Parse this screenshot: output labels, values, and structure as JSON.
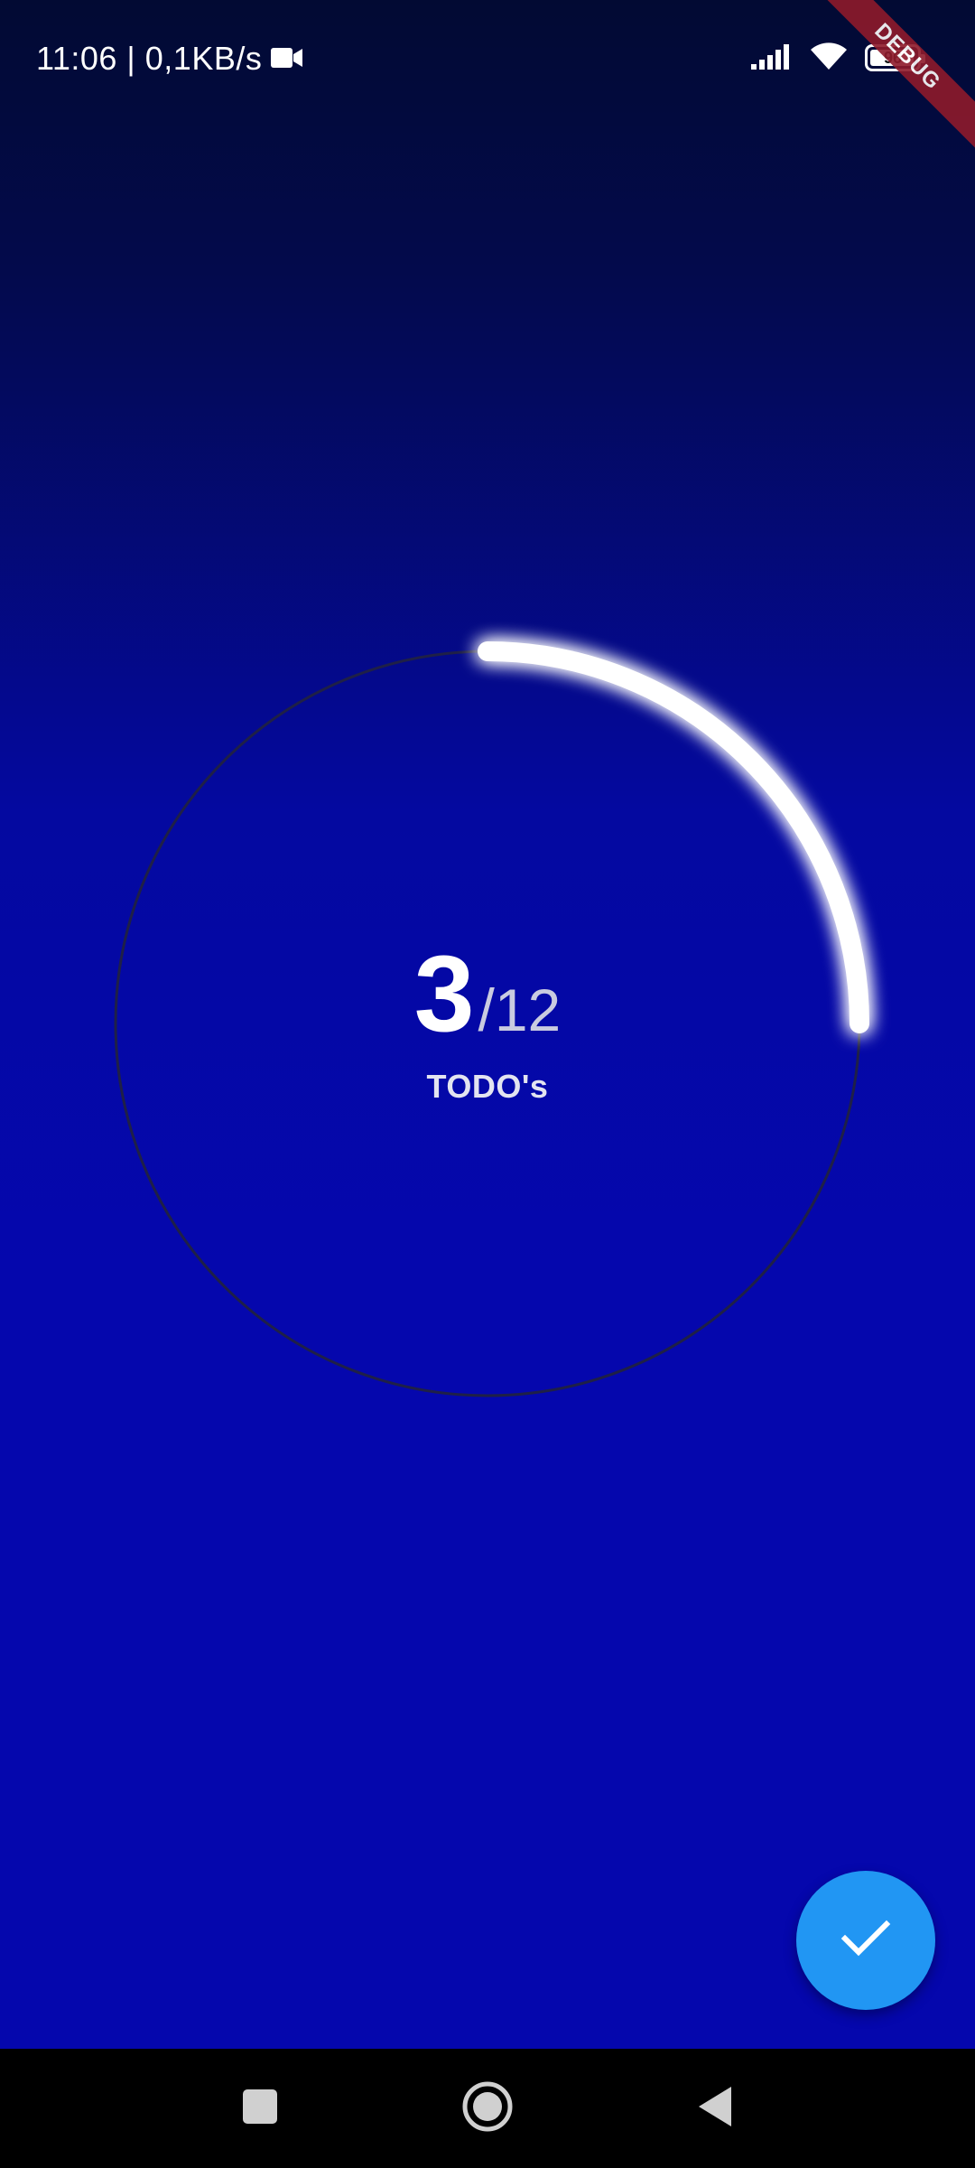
{
  "status_bar": {
    "time_speed": "11:06 | 0,1KB/s",
    "battery_level": "96",
    "icons": [
      "video-camera-icon",
      "signal-icon",
      "wifi-icon",
      "battery-icon"
    ]
  },
  "debug_banner": "DEBUG",
  "progress": {
    "current": "3",
    "separator": "/",
    "total": "12",
    "label": "TODO's",
    "fraction": 0.25
  },
  "fab": {
    "icon": "check-icon",
    "color": "#2196f3"
  },
  "nav_bar": {
    "icons": [
      "recent-apps-icon",
      "home-icon",
      "back-icon"
    ]
  },
  "colors": {
    "background_top": "#020a33",
    "background_bottom": "#0507ad",
    "ring_track": "#222244",
    "ring_progress": "#ffffff",
    "fab": "#2196f3"
  }
}
